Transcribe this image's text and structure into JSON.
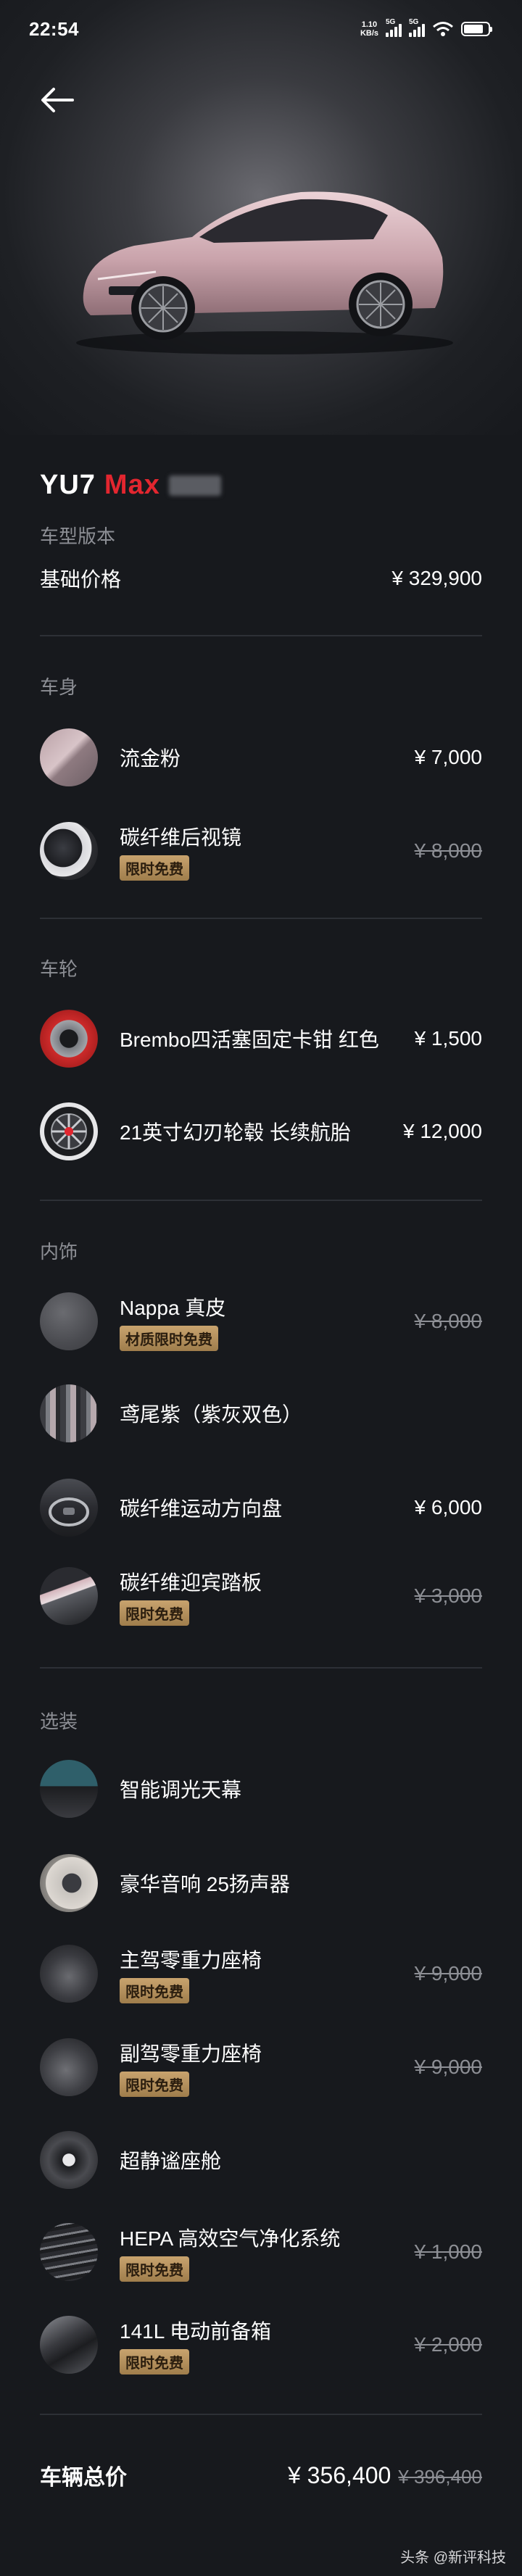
{
  "status_bar": {
    "time": "22:54",
    "net_speed_value": "1.10",
    "net_speed_unit": "KB/s",
    "sim1": "5G",
    "sim2": "5G"
  },
  "model": {
    "name": "YU7",
    "trim": "Max"
  },
  "version": {
    "label": "车型版本",
    "base_label": "基础价格",
    "base_price": "¥ 329,900"
  },
  "sections": {
    "body": {
      "title": "车身",
      "items": [
        {
          "name": "流金粉",
          "badge": "",
          "price": "¥ 7,000",
          "icon": "paint-swatch-icon"
        },
        {
          "name": "碳纤维后视镜",
          "badge": "限时免费",
          "price": "¥ 8,000",
          "icon": "mirror-icon"
        }
      ]
    },
    "wheels": {
      "title": "车轮",
      "items": [
        {
          "name": "Brembo四活塞固定卡钳 红色",
          "badge": "",
          "price": "¥ 1,500",
          "icon": "brake-caliper-icon"
        },
        {
          "name": "21英寸幻刃轮毂 长续航胎",
          "badge": "",
          "price": "¥ 12,000",
          "icon": "wheel-icon"
        }
      ]
    },
    "interior": {
      "title": "内饰",
      "items": [
        {
          "name": "Nappa 真皮",
          "badge": "材质限时免费",
          "price": "¥ 8,000",
          "icon": "leather-icon"
        },
        {
          "name": "鸢尾紫（紫灰双色）",
          "badge": "",
          "price": "",
          "icon": "interior-color-icon"
        },
        {
          "name": "碳纤维运动方向盘",
          "badge": "",
          "price": "¥ 6,000",
          "icon": "steering-wheel-icon"
        },
        {
          "name": "碳纤维迎宾踏板",
          "badge": "限时免费",
          "price": "¥ 3,000",
          "icon": "sill-plate-icon"
        }
      ]
    },
    "options": {
      "title": "选装",
      "items": [
        {
          "name": "智能调光天幕",
          "badge": "",
          "price": "",
          "icon": "sunroof-icon"
        },
        {
          "name": "豪华音响 25扬声器",
          "badge": "",
          "price": "",
          "icon": "speaker-icon"
        },
        {
          "name": "主驾零重力座椅",
          "badge": "限时免费",
          "price": "¥ 9,000",
          "icon": "driver-seat-icon"
        },
        {
          "name": "副驾零重力座椅",
          "badge": "限时免费",
          "price": "¥ 9,000",
          "icon": "passenger-seat-icon"
        },
        {
          "name": "超静谧座舱",
          "badge": "",
          "price": "",
          "icon": "quiet-cabin-icon"
        },
        {
          "name": "HEPA 高效空气净化系统",
          "badge": "限时免费",
          "price": "¥ 1,000",
          "icon": "air-filter-icon"
        },
        {
          "name": "141L 电动前备箱",
          "badge": "限时免费",
          "price": "¥ 2,000",
          "icon": "frunk-icon"
        }
      ]
    }
  },
  "total": {
    "label": "车辆总价",
    "price": "¥ 356,400",
    "original": "¥ 396,400"
  },
  "watermark": "头条 @新评科技",
  "colors": {
    "background": "#17191d",
    "accent_red": "#e3262f",
    "badge_gold": "#c8a36e",
    "muted": "#8d8f95",
    "car_paint": "#d9b8bf"
  }
}
